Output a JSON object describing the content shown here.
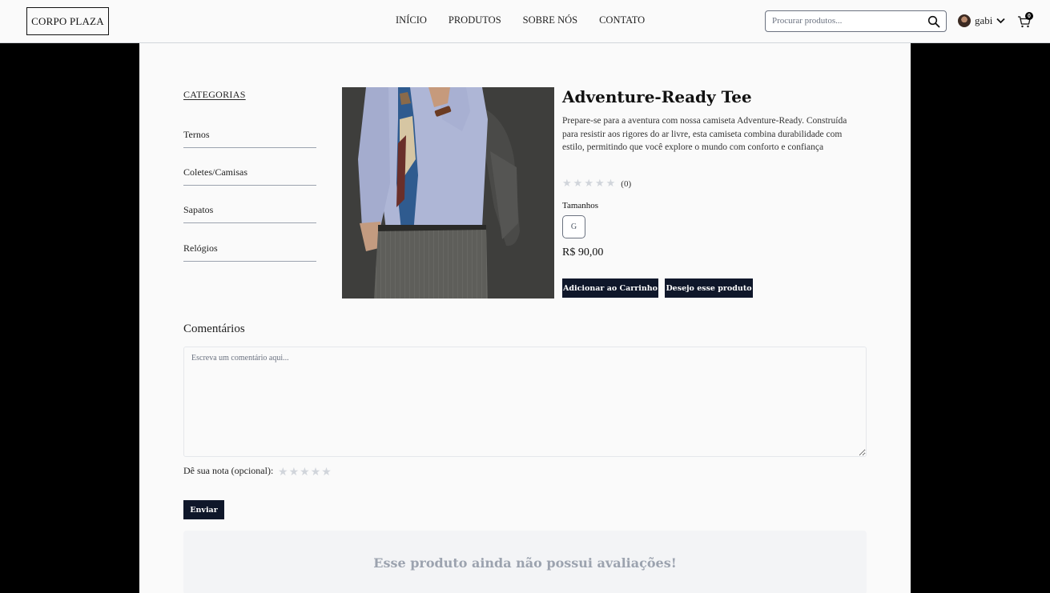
{
  "brand": {
    "logo_text": "CORPO PLAZA"
  },
  "nav": {
    "items": [
      "INÍCIO",
      "PRODUTOS",
      "SOBRE NÓS",
      "CONTATO"
    ]
  },
  "search": {
    "placeholder": "Procurar produtos..."
  },
  "user": {
    "name": "gabi"
  },
  "cart": {
    "count": "0"
  },
  "categories": {
    "title": "CATEGORIAS",
    "items": [
      "Ternos",
      "Coletes/Camisas",
      "Sapatos",
      "Relógios"
    ]
  },
  "product": {
    "title": "Adventure-Ready Tee",
    "description": "Prepare-se para a aventura com nossa camiseta Adventure-Ready. Construída para resistir aos rigores do ar livre, esta camiseta combina durabilidade com estilo, permitindo que você explore o mundo com conforto e confiança",
    "rating_count": "(0)",
    "rating_value": 0,
    "sizes_label": "Tamanhos",
    "sizes": [
      "G"
    ],
    "price": "R$ 90,00",
    "add_to_cart": "Adicionar ao Carrinho",
    "wishlist": "Desejo esse produto"
  },
  "comments": {
    "title": "Comentários",
    "placeholder": "Escreva um comentário aqui...",
    "rate_label": "Dê sua nota (opcional):",
    "submit": "Enviar",
    "empty_message": "Esse produto ainda não possui avaliações!"
  },
  "colors": {
    "accent_dark": "#0f172a",
    "star_empty": "#d1d5db",
    "panel_bg": "#f3f4f6"
  }
}
